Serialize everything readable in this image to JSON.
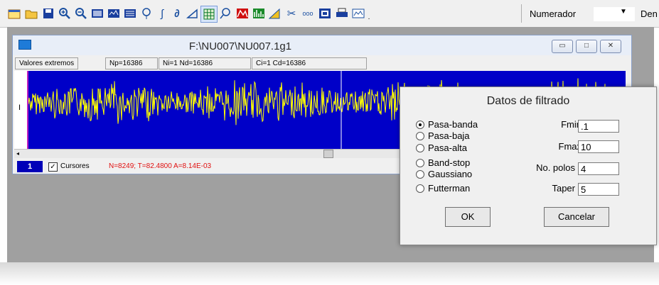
{
  "toolbar": {
    "icons": [
      "calendar-icon",
      "open-folder-icon",
      "save-icon",
      "zoom-in-icon",
      "zoom-out-icon",
      "display-icon",
      "display-alt-icon",
      "list-icon",
      "balloon-icon",
      "integral-icon",
      "derivative-icon",
      "triangle-icon",
      "grid-icon",
      "lasso-icon",
      "spectrum-icon",
      "bar-spectrum-icon",
      "filter-icon",
      "cut-icon",
      "dots-icon",
      "frame-icon",
      "print-icon",
      "chart-icon",
      "dropdown-icon"
    ],
    "numerador_label": "Numerador",
    "denominador_label": "Den"
  },
  "child_window": {
    "title": "F:\\NU007\\NU007.1g1",
    "status": [
      "Valores extremos",
      "Np=16386",
      "Ni=1 Nd=16386",
      "Ci=1 Cd=16386"
    ],
    "channel_label": "I",
    "channel_number": "1",
    "cursors_label": "Cursores",
    "cursors_checked": true,
    "cursor_info": "N=8249; T=82.4800  A=8.14E-03"
  },
  "dialog": {
    "title": "Datos de filtrado",
    "filter_types": [
      "Pasa-banda",
      "Pasa-baja",
      "Pasa-alta",
      "Band-stop",
      "Gaussiano",
      "Futterman"
    ],
    "selected_filter": "Pasa-banda",
    "fields": [
      {
        "label": "Fmin",
        "value": ".1"
      },
      {
        "label": "Fmax",
        "value": "10"
      },
      {
        "label": "No. polos",
        "value": "4"
      },
      {
        "label": "Taper",
        "value": "5"
      }
    ],
    "ok_label": "OK",
    "cancel_label": "Cancelar"
  },
  "colors": {
    "plot_background": "#0000c8",
    "signal": "#ffff00",
    "cursor_info": "#e01010"
  }
}
